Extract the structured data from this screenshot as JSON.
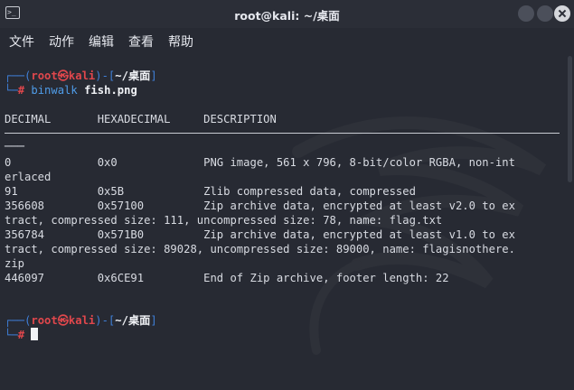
{
  "window": {
    "title": "root@kali: ~/桌面",
    "icon": "terminal-icon"
  },
  "menu": [
    "文件",
    "动作",
    "编辑",
    "查看",
    "帮助"
  ],
  "prompt": {
    "corner_top": "┌──(",
    "user": "root㉿kali",
    "mid": ")-[",
    "path": "~/桌面",
    "end": "]",
    "corner_bottom": "└─",
    "hash": "#"
  },
  "command": {
    "program": "binwalk",
    "argument": "fish.png"
  },
  "output": {
    "header": "DECIMAL       HEXADECIMAL     DESCRIPTION",
    "separator_tail": "───",
    "lines": [
      "0             0x0             PNG image, 561 x 796, 8-bit/color RGBA, non-int",
      "erlaced",
      "91            0x5B            Zlib compressed data, compressed",
      "356608        0x57100         Zip archive data, encrypted at least v2.0 to ex",
      "tract, compressed size: 111, uncompressed size: 78, name: flag.txt",
      "356784        0x571B0         Zip archive data, encrypted at least v1.0 to ex",
      "tract, compressed size: 89028, uncompressed size: 89000, name: flagisnothere.",
      "zip",
      "446097        0x6CE91         End of Zip archive, footer length: 22"
    ]
  },
  "colors": {
    "background": "#272a33",
    "prompt_bracket": "#3f7fd8",
    "prompt_user": "#e0474c",
    "command": "#4f9ce8"
  }
}
